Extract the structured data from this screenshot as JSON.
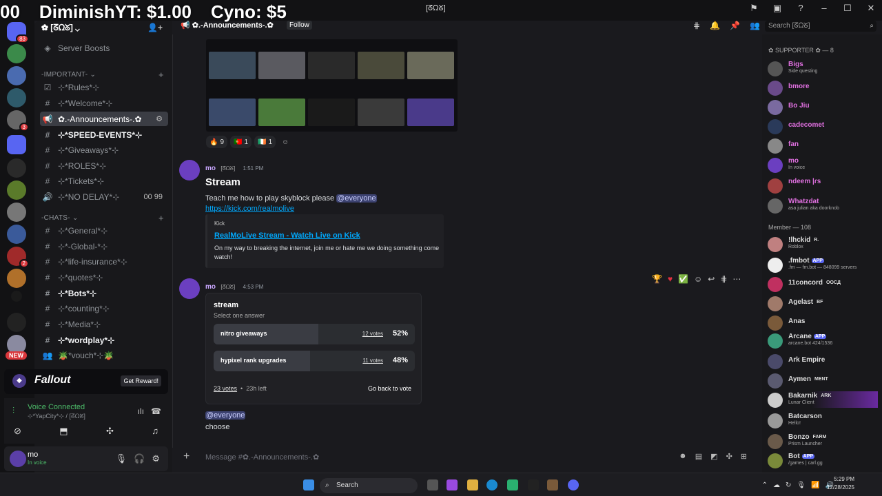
{
  "ticker": [
    "00",
    "DiminishYT: $1.00",
    "Cyno: $5"
  ],
  "window": {
    "title": "[ᘔᘯᘜ]",
    "min": "–",
    "max": "☐",
    "close": "✕"
  },
  "guild": {
    "name": "✿ [ᘔᘯᘜ] ⌄"
  },
  "sidebar": {
    "server_boosts": "Server Boosts",
    "cat_important": "-IMPORTANT-",
    "cat_chats": "-CHATS-",
    "channels_important": [
      {
        "label": "⊹*Rules*⊹",
        "icon": "☑"
      },
      {
        "label": "⊹*Welcome*⊹",
        "icon": "#"
      },
      {
        "label": "✿.-Announcements-.✿",
        "icon": "📢"
      },
      {
        "label": "⊹*SPEED-EVENTS*⊹",
        "icon": "#"
      },
      {
        "label": "⊹*Giveaways*⊹",
        "icon": "#"
      },
      {
        "label": "⊹*ROLES*⊹",
        "icon": "#"
      },
      {
        "label": "⊹*Tickets*⊹",
        "icon": "#"
      },
      {
        "label": "⊹*NO DELAY*⊹",
        "icon": "🔊",
        "right": "00  99"
      }
    ],
    "channels_chats": [
      {
        "label": "⊹*General*⊹",
        "icon": "#"
      },
      {
        "label": "⊹*-Global-*⊹",
        "icon": "#"
      },
      {
        "label": "⊹*life-insurance*⊹",
        "icon": "#"
      },
      {
        "label": "⊹*quotes*⊹",
        "icon": "#"
      },
      {
        "label": "⊹*Bots*⊹",
        "icon": "#"
      },
      {
        "label": "⊹*counting*⊹",
        "icon": "#"
      },
      {
        "label": "⊹*Media*⊹",
        "icon": "#"
      },
      {
        "label": "⊹*wordplay*⊹",
        "icon": "#"
      },
      {
        "label": "🪴*vouch*⊹🪴",
        "icon": "👥"
      }
    ]
  },
  "servers": {
    "new_badge": "NEW",
    "badge_83": "83",
    "badge_3": "3",
    "badge_2": "2"
  },
  "promo": {
    "title": "Fallout",
    "button": "Get Reward!"
  },
  "voice": {
    "status": "Voice Connected",
    "channel": "⊹*YapCity*⊹ / [ᘔᘯᘜ]"
  },
  "user": {
    "name": "mo",
    "status": "In voice"
  },
  "header": {
    "channel": "✿.-Announcements-.✿",
    "follow": "Follow"
  },
  "search": {
    "placeholder": "Search [ᘔᘯᘜ]"
  },
  "reactions": [
    {
      "emoji": "🔥",
      "count": "9"
    },
    {
      "emoji": "🇵🇹",
      "count": "1"
    },
    {
      "emoji": "🇮🇪",
      "count": "1"
    }
  ],
  "msg1": {
    "author": "mo",
    "tag": "[ᘔᘯᘜ]",
    "time": "1:51 PM",
    "title": "Stream",
    "text": "Teach me how to play skyblock please ",
    "mention": "@everyone",
    "link": "https://kick.com/realmolive"
  },
  "embed": {
    "provider": "Kick",
    "title": "RealMoLive Stream - Watch Live on Kick",
    "desc": "On my way to breaking the internet, join me or hate me we doing something come watch!"
  },
  "msg2": {
    "author": "mo",
    "tag": "[ᘔᘯᘜ]",
    "time": "4:53 PM",
    "mention": "@everyone",
    "text": "choose"
  },
  "poll": {
    "question": "stream",
    "subtitle": "Select one answer",
    "options": [
      {
        "label": "nitro giveaways",
        "votes": "12 votes",
        "pct": "52%",
        "share": 0.52
      },
      {
        "label": "hypixel rank upgrades",
        "votes": "11 votes",
        "pct": "48%",
        "share": 0.48
      }
    ],
    "total": "23 votes",
    "left": "23h left",
    "back": "Go back to vote"
  },
  "input": {
    "placeholder": "Message #✿.-Announcements-.✿"
  },
  "members": {
    "supporter_head": "✿ SUPPORTER ✿ — 8",
    "member_head": "Member — 108",
    "supporters": [
      {
        "name": "Bigs",
        "status": "Side questing",
        "color": "#e070e0"
      },
      {
        "name": "bmore",
        "status": "",
        "color": "#e070e0"
      },
      {
        "name": "Bo Jiu",
        "status": "",
        "color": "#e070e0"
      },
      {
        "name": "cadecomet",
        "status": "",
        "color": "#e070e0"
      },
      {
        "name": "fan",
        "status": "",
        "color": "#e070e0"
      },
      {
        "name": "mo",
        "status": "In voice",
        "color": "#e070e0"
      },
      {
        "name": "ndeem |ɾs",
        "status": "",
        "color": "#e070e0"
      },
      {
        "name": "Whatzdat",
        "status": "asa julian aka doorknob",
        "color": "#e070e0"
      }
    ],
    "members": [
      {
        "name": "!lhckid",
        "status": "Roblox",
        "tag": "R."
      },
      {
        "name": ".fmbot",
        "status": ".fm — fm.bot — 848099 servers",
        "tag": "APP"
      },
      {
        "name": "11concord",
        "status": "",
        "tag": "OOCД"
      },
      {
        "name": "Agelast",
        "status": "",
        "tag": "BF"
      },
      {
        "name": "Anas",
        "status": "",
        "tag": ""
      },
      {
        "name": "Arcane",
        "status": "arcane.bot 424/1536",
        "tag": "APP"
      },
      {
        "name": "Ark Empire",
        "status": "",
        "tag": ""
      },
      {
        "name": "Aymen",
        "status": "",
        "tag": "MENT"
      },
      {
        "name": "Bakarnik",
        "status": "Lunar Client",
        "tag": "ARK"
      },
      {
        "name": "Batcarson",
        "status": "Hello!",
        "tag": ""
      },
      {
        "name": "Bonzo",
        "status": "Prism Launcher",
        "tag": "FARM"
      },
      {
        "name": "Bot",
        "status": "/games | carl.gg",
        "tag": "APP"
      }
    ]
  },
  "taskbar": {
    "search": "Search",
    "time": "5:29 PM",
    "date": "12/28/2025"
  }
}
